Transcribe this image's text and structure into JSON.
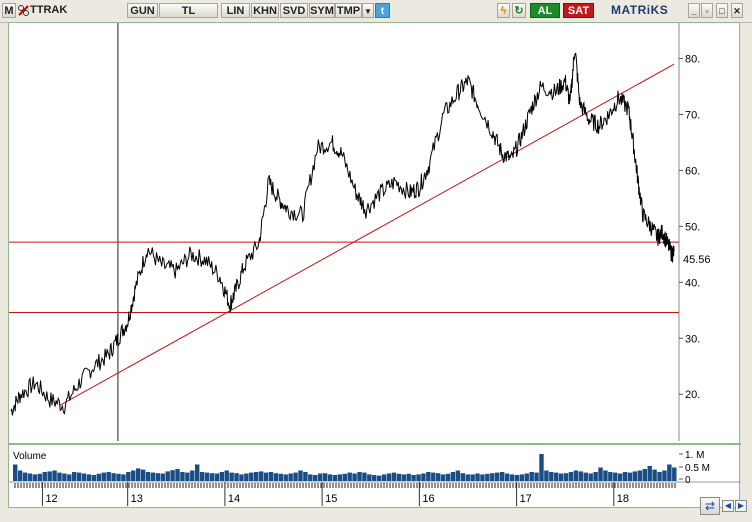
{
  "toolbar": {
    "menu_label": "M",
    "symbol": "TTRAK",
    "period": "GUN",
    "currency": "TL",
    "scale": "LIN",
    "items": [
      "KHN",
      "SVD",
      "SYM",
      "TMP"
    ],
    "buy_label": "AL",
    "sell_label": "SAT",
    "brand": "MATRiKS"
  },
  "chart_data": {
    "type": "line",
    "price_axis": {
      "min": 12,
      "max": 86,
      "ticks": [
        20,
        30,
        40,
        50,
        60,
        70,
        80
      ]
    },
    "tick_labels": [
      "20.",
      "30.",
      "40.",
      "50.",
      "60.",
      "70.",
      "80."
    ],
    "last_price": 45.56,
    "last_price_label": "45.56",
    "x_labels": [
      "12",
      "13",
      "14",
      "15",
      "16",
      "17",
      "18"
    ],
    "x_domain": [
      11.8,
      18.65
    ],
    "vertical_marker_x": 12.9,
    "horizontal_lines": [
      47.2,
      34.6
    ],
    "trendline": {
      "from": [
        12.3,
        18
      ],
      "to": [
        18.62,
        79
      ]
    },
    "series": [
      {
        "values": [
          [
            11.8,
            17
          ],
          [
            11.9,
            20
          ],
          [
            12.05,
            22
          ],
          [
            12.2,
            19
          ],
          [
            12.35,
            18
          ],
          [
            12.5,
            22
          ],
          [
            12.65,
            25
          ],
          [
            12.8,
            27
          ],
          [
            12.9,
            30
          ],
          [
            13.0,
            33
          ],
          [
            13.08,
            39
          ],
          [
            13.2,
            46
          ],
          [
            13.35,
            43
          ],
          [
            13.5,
            42
          ],
          [
            13.65,
            45
          ],
          [
            13.8,
            44
          ],
          [
            13.95,
            41
          ],
          [
            14.05,
            36
          ],
          [
            14.1,
            38
          ],
          [
            14.2,
            43
          ],
          [
            14.35,
            47
          ],
          [
            14.45,
            58
          ],
          [
            14.55,
            55
          ],
          [
            14.65,
            53
          ],
          [
            14.8,
            52
          ],
          [
            14.95,
            64
          ],
          [
            15.1,
            65
          ],
          [
            15.2,
            63
          ],
          [
            15.35,
            56
          ],
          [
            15.45,
            53
          ],
          [
            15.6,
            56
          ],
          [
            15.75,
            58
          ],
          [
            15.9,
            56
          ],
          [
            16.0,
            57
          ],
          [
            16.1,
            61
          ],
          [
            16.25,
            70
          ],
          [
            16.4,
            74
          ],
          [
            16.5,
            76
          ],
          [
            16.6,
            72
          ],
          [
            16.75,
            67
          ],
          [
            16.85,
            63
          ],
          [
            16.95,
            62
          ],
          [
            17.05,
            66
          ],
          [
            17.15,
            71
          ],
          [
            17.25,
            75
          ],
          [
            17.4,
            74
          ],
          [
            17.5,
            76
          ],
          [
            17.55,
            72
          ],
          [
            17.6,
            82
          ],
          [
            17.65,
            72
          ],
          [
            17.75,
            69
          ],
          [
            17.85,
            68
          ],
          [
            17.95,
            70
          ],
          [
            18.05,
            73
          ],
          [
            18.15,
            71
          ],
          [
            18.2,
            65
          ],
          [
            18.25,
            58
          ],
          [
            18.3,
            52
          ],
          [
            18.38,
            50
          ],
          [
            18.45,
            48
          ],
          [
            18.5,
            49
          ],
          [
            18.55,
            47
          ],
          [
            18.6,
            45
          ],
          [
            18.62,
            45.56
          ]
        ]
      }
    ],
    "volume": {
      "ticks_labels": [
        "1. M",
        "0.5 M",
        "0"
      ],
      "label": "Volume",
      "values": [
        0.55,
        0.35,
        0.28,
        0.25,
        0.22,
        0.24,
        0.3,
        0.32,
        0.35,
        0.28,
        0.25,
        0.22,
        0.3,
        0.28,
        0.25,
        0.22,
        0.2,
        0.24,
        0.28,
        0.3,
        0.26,
        0.24,
        0.22,
        0.3,
        0.35,
        0.42,
        0.38,
        0.3,
        0.28,
        0.26,
        0.25,
        0.32,
        0.36,
        0.4,
        0.3,
        0.28,
        0.35,
        0.55,
        0.3,
        0.28,
        0.26,
        0.25,
        0.3,
        0.35,
        0.28,
        0.26,
        0.22,
        0.25,
        0.28,
        0.3,
        0.32,
        0.28,
        0.3,
        0.26,
        0.24,
        0.22,
        0.25,
        0.28,
        0.35,
        0.3,
        0.22,
        0.2,
        0.25,
        0.26,
        0.22,
        0.2,
        0.22,
        0.24,
        0.28,
        0.25,
        0.3,
        0.28,
        0.22,
        0.2,
        0.18,
        0.22,
        0.25,
        0.28,
        0.24,
        0.22,
        0.24,
        0.2,
        0.22,
        0.25,
        0.3,
        0.28,
        0.26,
        0.22,
        0.24,
        0.3,
        0.35,
        0.26,
        0.22,
        0.22,
        0.25,
        0.22,
        0.24,
        0.26,
        0.28,
        0.3,
        0.25,
        0.22,
        0.2,
        0.22,
        0.25,
        0.3,
        0.28,
        0.9,
        0.35,
        0.3,
        0.28,
        0.25,
        0.26,
        0.3,
        0.35,
        0.32,
        0.28,
        0.25,
        0.3,
        0.45,
        0.35,
        0.3,
        0.28,
        0.25,
        0.3,
        0.28,
        0.32,
        0.35,
        0.4,
        0.5,
        0.38,
        0.3,
        0.35,
        0.55,
        0.45
      ]
    }
  },
  "colors": {
    "price_line": "#000000",
    "support_lines": "#cc1111",
    "volume_bars": "#1a4d85"
  },
  "icons": [
    "twitter-icon",
    "lightning-icon",
    "refresh-icon",
    "scroll-nav-icon"
  ]
}
